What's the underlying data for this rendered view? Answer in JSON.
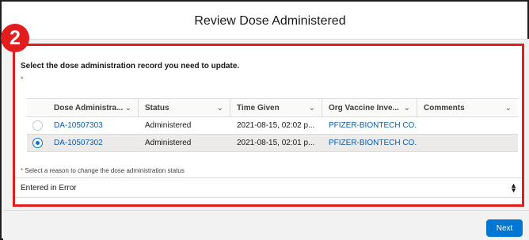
{
  "modal": {
    "title": "Review Dose Administered"
  },
  "step_badge": "2",
  "instruction": "Select the dose administration record you need to update.",
  "required_mark": "*",
  "table": {
    "columns": [
      {
        "label": "Dose Administra..."
      },
      {
        "label": "Status"
      },
      {
        "label": "Time Given"
      },
      {
        "label": "Org Vaccine Inve..."
      },
      {
        "label": "Comments"
      }
    ],
    "rows": [
      {
        "dose": "DA-10507303",
        "status": "Administered",
        "time": "2021-08-15, 02:02 p...",
        "org": "PFIZER-BIONTECH CO...",
        "comments": "",
        "selected": false
      },
      {
        "dose": "DA-10507302",
        "status": "Administered",
        "time": "2021-08-15, 02:01 p...",
        "org": "PFIZER-BIONTECH CO...",
        "comments": "",
        "selected": true
      }
    ]
  },
  "reason": {
    "required_mark": "*",
    "label": "Select a reason to change the dose administration status",
    "value": "Entered in Error"
  },
  "footer": {
    "next_label": "Next"
  },
  "icons": {
    "sort": "chevron-down-icon",
    "select": "select-arrows-icon"
  },
  "colors": {
    "accent": "#0176d3",
    "highlight": "#e31d1d",
    "link": "#0b5cab"
  }
}
